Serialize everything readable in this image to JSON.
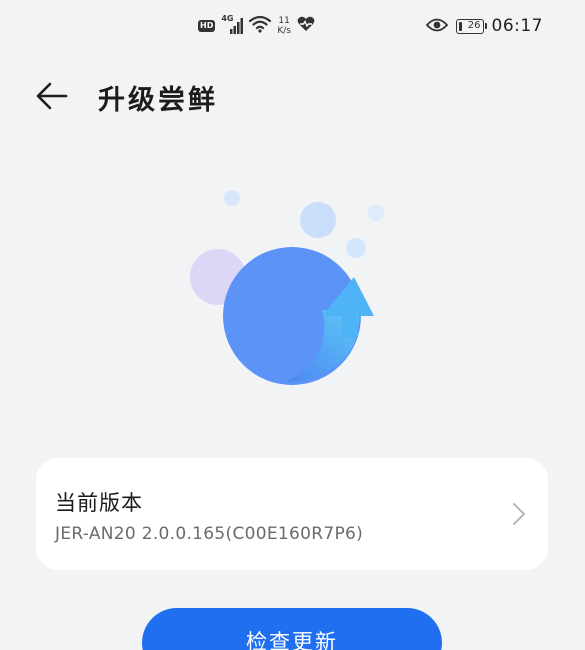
{
  "status_bar": {
    "hd_label": "HD",
    "network_type": "4G",
    "speed_value": "11",
    "speed_unit": "K/s",
    "battery_level": "26",
    "time": "06:17"
  },
  "header": {
    "back_icon": "arrow-left-icon",
    "title": "升级尝鲜"
  },
  "illustration": {
    "icon": "update-arrow-icon",
    "colors": {
      "main_circle": "#5c93f7",
      "arrow": "#4fb4f5",
      "purple_bubble": "#d9d3f7",
      "blue_bubble": "#c9def9"
    }
  },
  "version_card": {
    "title": "当前版本",
    "version": "JER-AN20 2.0.0.165(C00E160R7P6)",
    "chevron_icon": "chevron-right-icon"
  },
  "actions": {
    "check_update_label": "检查更新"
  },
  "colors": {
    "background": "#f1f3f5",
    "card": "#ffffff",
    "accent": "#1f6ff0"
  }
}
